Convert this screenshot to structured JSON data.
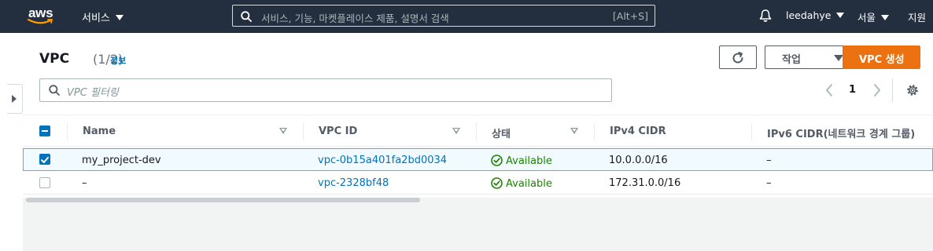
{
  "topnav": {
    "logo_text": "aws",
    "services_label": "서비스",
    "search_placeholder": "서비스, 기능, 마켓플레이스 제품, 설명서 검색",
    "search_shortcut": "[Alt+S]",
    "user_label": "leedahye",
    "region_label": "서울",
    "support_label": "지원"
  },
  "header": {
    "title": "VPC",
    "count": "(1/2)",
    "info_link": "정보",
    "actions_label": "작업",
    "create_label": "VPC 생성"
  },
  "filter": {
    "placeholder": "VPC 필터링"
  },
  "pagination": {
    "current_page": "1"
  },
  "table": {
    "columns": [
      "Name",
      "VPC ID",
      "상태",
      "IPv4 CIDR",
      "IPv6 CIDR(네트워크 경계 그룹)"
    ],
    "rows": [
      {
        "selected": true,
        "name": "my_project-dev",
        "vpc_id": "vpc-0b15a401fa2bd0034",
        "state": "Available",
        "ipv4": "10.0.0.0/16",
        "ipv6": "–"
      },
      {
        "selected": false,
        "name": "–",
        "vpc_id": "vpc-2328bf48",
        "state": "Available",
        "ipv4": "172.31.0.0/16",
        "ipv6": "–"
      }
    ]
  },
  "colors": {
    "nav_bg": "#232f3e",
    "primary_orange": "#ec7211",
    "link_blue": "#0073bb",
    "success_green": "#1d8102",
    "selected_row_bg": "#f1faff"
  }
}
